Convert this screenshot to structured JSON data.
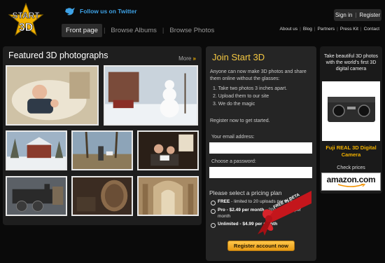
{
  "brand": {
    "logo_line1": "START",
    "logo_line2": "3D"
  },
  "header": {
    "twitter_label": "Follow us on Twitter",
    "auth": {
      "signin": "Sign in",
      "separator": "|",
      "register": "Register"
    },
    "nav": [
      {
        "label": "Front page",
        "active": true
      },
      {
        "label": "Browse Albums",
        "active": false
      },
      {
        "label": "Browse Photos",
        "active": false
      }
    ],
    "nav_separator": "|",
    "toplinks": [
      "About us",
      "Blog",
      "Partners",
      "Press Kit",
      "Contact"
    ],
    "toplinks_separator": "|"
  },
  "featured": {
    "title": "Featured 3D photographs",
    "more_label": "More",
    "more_arrows": "»",
    "photos": [
      {
        "subject": "baby-on-pillow-photo"
      },
      {
        "subject": "snowman-yard-photo"
      },
      {
        "subject": "snowy-house-photo"
      },
      {
        "subject": "people-in-woods-photo"
      },
      {
        "subject": "family-reading-photo"
      },
      {
        "subject": "steam-locomotive-photo"
      },
      {
        "subject": "barrel-cellar-photo"
      },
      {
        "subject": "church-interior-photo"
      }
    ]
  },
  "join": {
    "title": "Join Start 3D",
    "intro": "Anyone can now make 3D photos and share them online without the glasses:",
    "steps": [
      "Take two photos 3 inches apart.",
      "Upload them to our site",
      "We do the magic"
    ],
    "register_now": "Register now to get started.",
    "email_label": "Your email address:",
    "password_label": "Choose a password:",
    "pricing_title": "Please select a pricing plan",
    "ribbon_text": "FREE IN BETA",
    "plans": [
      {
        "name": "FREE",
        "rest": " - limited to 20 uploads per month"
      },
      {
        "name": "Pro - $2.49 per month",
        "rest": " - 200 uploads per month"
      },
      {
        "name": "Unlimited - $4.99 per month",
        "rest": ""
      }
    ],
    "register_button": "Register account now"
  },
  "ad": {
    "text": "Take beautiful 3D photos with the world's first 3D digital camera",
    "product": "Fuji REAL 3D Digital Camera",
    "check_prices": "Check prices",
    "amazon": "amazon.com"
  },
  "colors": {
    "accent": "#f3b200",
    "twitter": "#3ea2e6",
    "join_title": "#f5c842",
    "background": "#0a0a0a"
  }
}
